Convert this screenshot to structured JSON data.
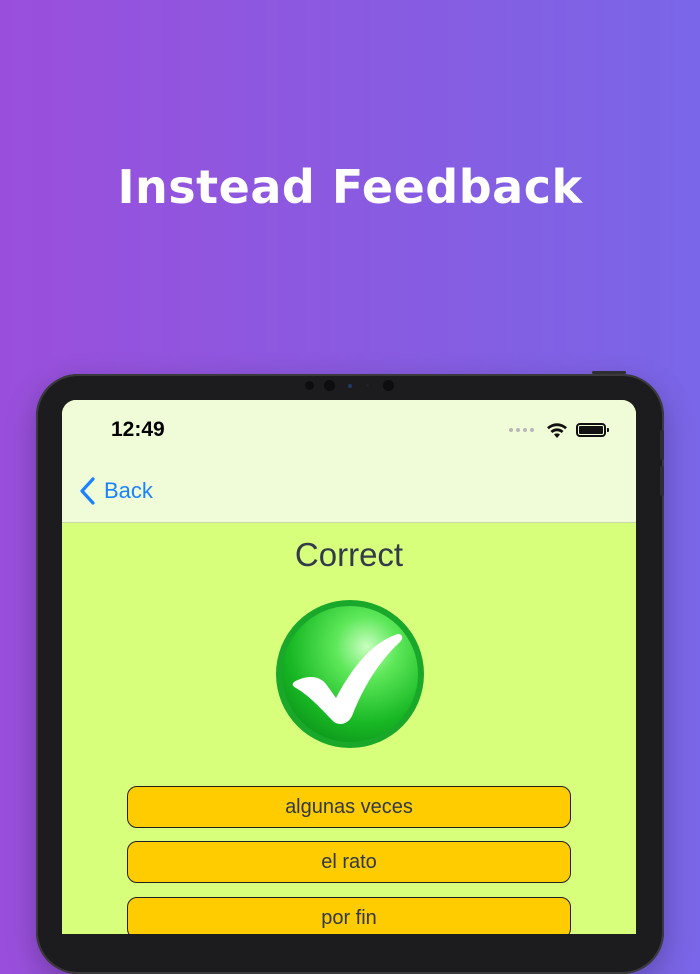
{
  "promo": {
    "headline": "Instead Feedback"
  },
  "status_bar": {
    "time": "12:49",
    "wifi_icon": "wifi-icon",
    "battery_icon": "battery-icon"
  },
  "nav": {
    "back_label": "Back",
    "back_icon": "chevron-left-icon"
  },
  "result": {
    "title": "Correct",
    "icon": "checkmark-circle-icon"
  },
  "answers": [
    {
      "label": "algunas veces"
    },
    {
      "label": "el rato"
    },
    {
      "label": "por fin"
    }
  ],
  "colors": {
    "background_gradient_start": "#9a4fdc",
    "background_gradient_end": "#7a66e8",
    "screen_bg": "#d7ff7c",
    "navbar_bg": "#f0fcd7",
    "accent_blue": "#1a82ff",
    "answer_button_bg": "#ffcc00",
    "check_green": "#22c02c"
  }
}
